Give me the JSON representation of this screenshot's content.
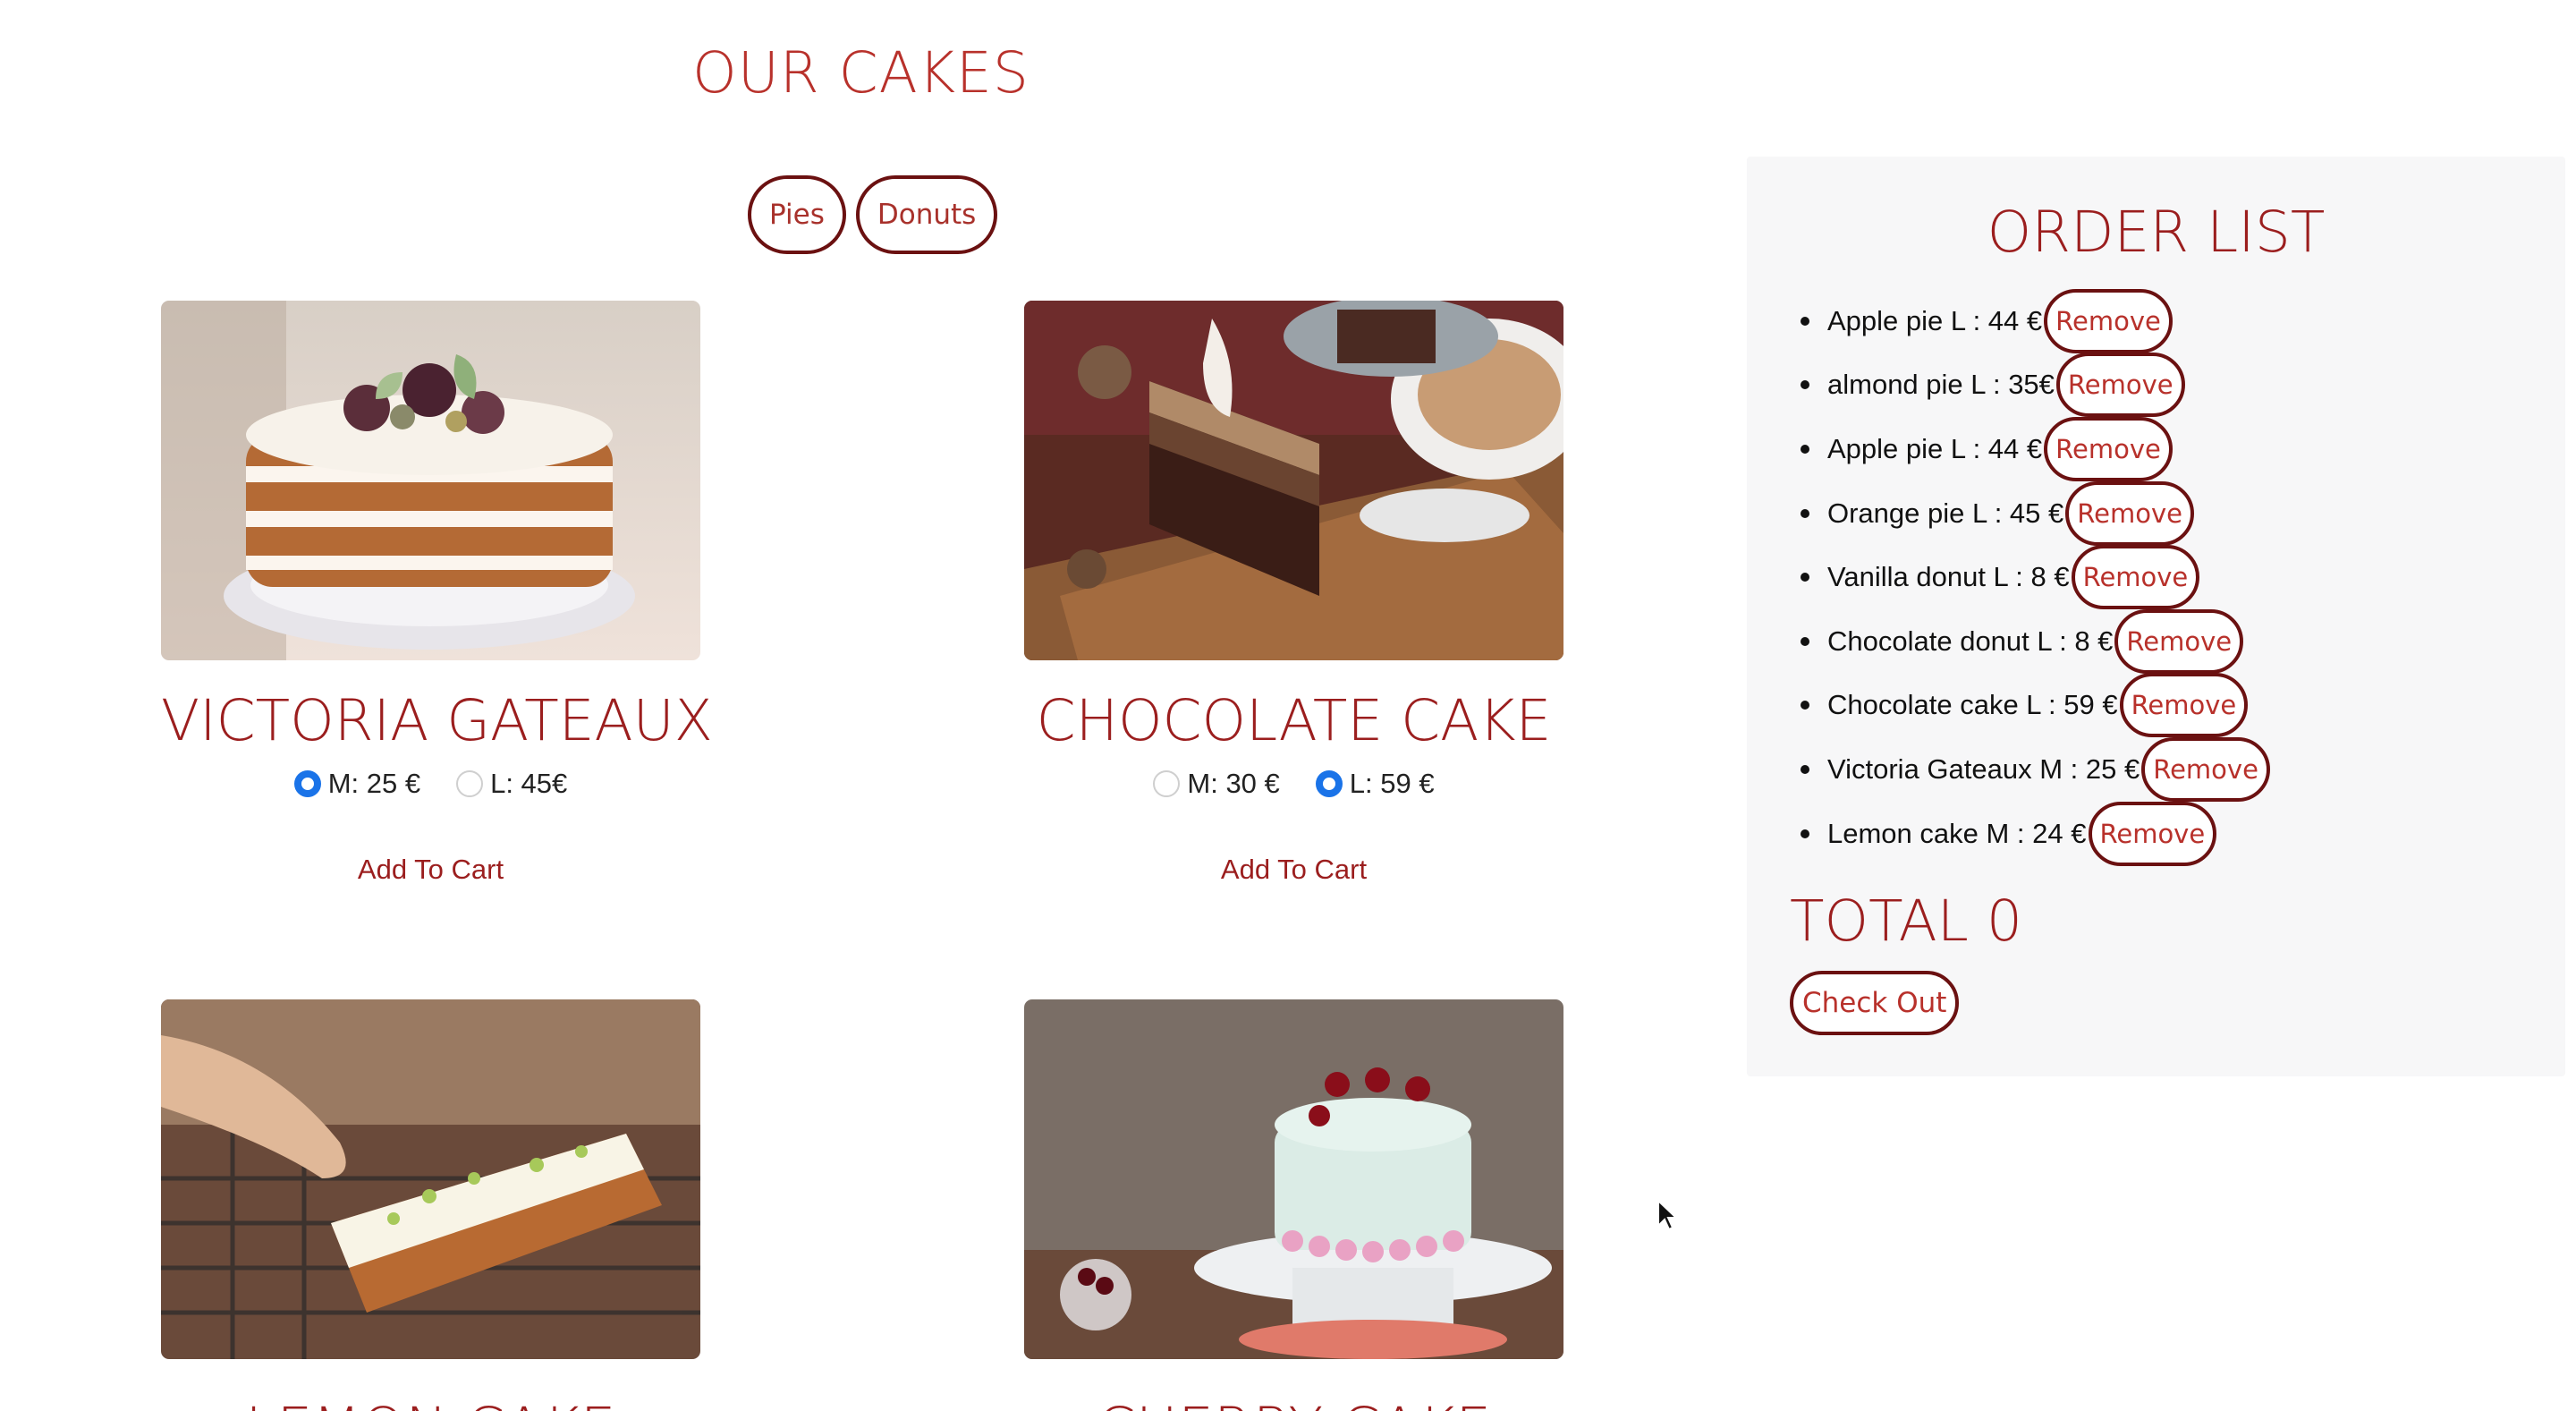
{
  "page": {
    "title": "OUR CAKES"
  },
  "filters": [
    {
      "label": "Pies"
    },
    {
      "label": "Donuts"
    }
  ],
  "products": [
    {
      "name": "VICTORIA GATEAUX",
      "image": "layered-naked-cake-with-figs-photo",
      "sizes": [
        {
          "label": "M: 25 €",
          "checked": true
        },
        {
          "label": "L: 45€",
          "checked": false
        }
      ],
      "add_label": "Add To Cart"
    },
    {
      "name": "CHOCOLATE CAKE",
      "image": "chocolate-cake-slice-with-coffee-photo",
      "sizes": [
        {
          "label": "M: 30 €",
          "checked": false
        },
        {
          "label": "L: 59 €",
          "checked": true
        }
      ],
      "add_label": "Add To Cart"
    },
    {
      "name": "LEMON CAKE",
      "image": "lemon-loaf-cake-with-frosting-photo"
    },
    {
      "name": "CHERRY CAKE",
      "image": "cherry-topped-cream-cake-on-stand-photo"
    }
  ],
  "order": {
    "title": "ORDER LIST",
    "items": [
      {
        "text": "Apple pie L : 44 €",
        "remove_label": "Remove"
      },
      {
        "text": "almond pie L : 35€",
        "remove_label": "Remove"
      },
      {
        "text": "Apple pie L : 44 €",
        "remove_label": "Remove"
      },
      {
        "text": "Orange pie L : 45 €",
        "remove_label": "Remove"
      },
      {
        "text": "Vanilla donut L : 8 €",
        "remove_label": "Remove"
      },
      {
        "text": "Chocolate donut L : 8 €",
        "remove_label": "Remove"
      },
      {
        "text": "Chocolate cake L : 59 €",
        "remove_label": "Remove"
      },
      {
        "text": "Victoria Gateaux M : 25 €",
        "remove_label": "Remove"
      },
      {
        "text": "Lemon cake M : 24 €",
        "remove_label": "Remove"
      }
    ],
    "total_label": "TOTAL 0",
    "checkout_label": "Check Out"
  },
  "colors": {
    "accent": "#9b1e1e",
    "title_red": "#b8312b",
    "button_border": "#6b1111",
    "radio_blue": "#1a73e8",
    "panel_bg": "#f7f7f8"
  }
}
